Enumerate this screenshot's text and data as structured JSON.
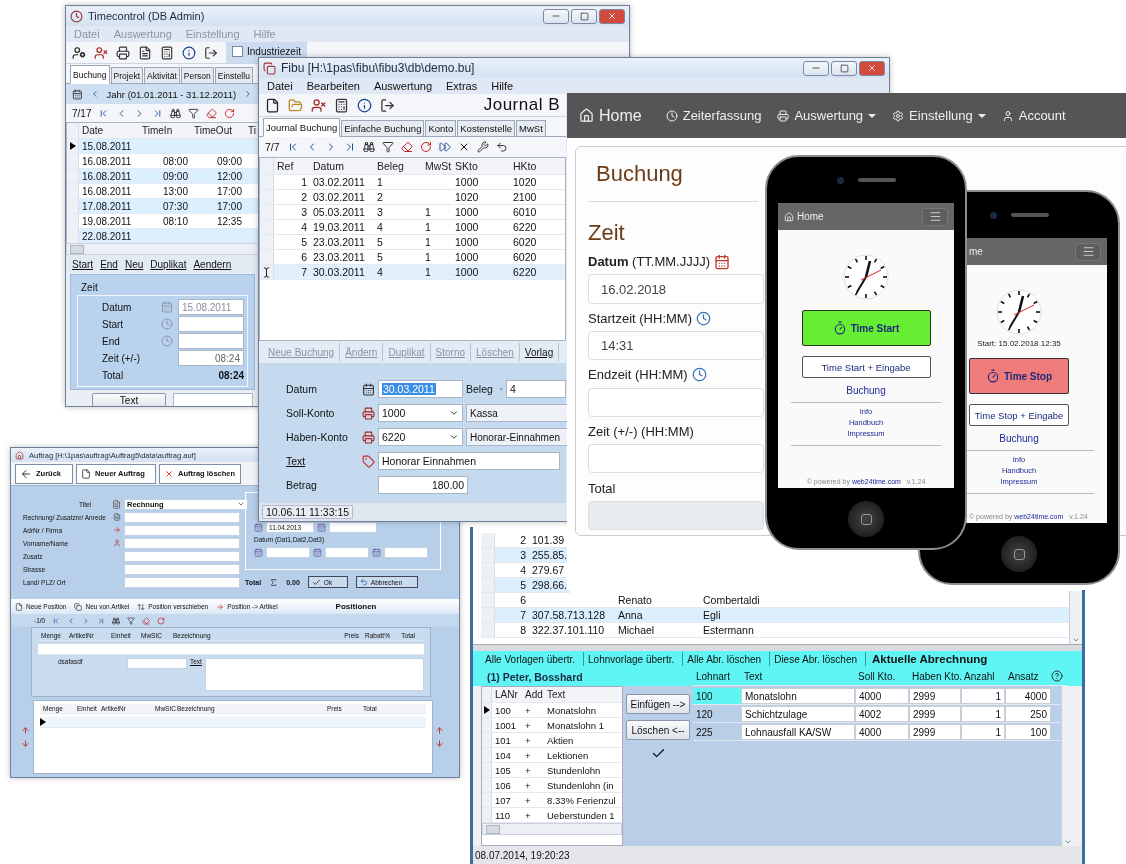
{
  "timecontrol": {
    "title": "Timecontrol (DB Admin)",
    "menu": [
      "Datei",
      "Auswertung",
      "Einstellung",
      "Hilfe"
    ],
    "option": {
      "label": "Industriezeit",
      "checked": false
    },
    "tabs": [
      {
        "label": "Buchung",
        "selected": true
      },
      {
        "label": "Projekt",
        "selected": false
      },
      {
        "label": "Aktivität",
        "selected": false
      },
      {
        "label": "Person",
        "selected": false
      },
      {
        "label": "Einstellu",
        "selected": false
      }
    ],
    "period": "Jahr (01.01.2011 - 31.12.2011)",
    "counter": "7/17",
    "columns": [
      "Date",
      "TimeIn",
      "TimeOut",
      "Ti"
    ],
    "rows": [
      {
        "date": "15.08.2011",
        "current": true
      },
      {
        "date": "16.08.2011",
        "time_in": "08:00",
        "time_out": "09:00",
        "current": false
      },
      {
        "date": "16.08.2011",
        "time_in": "09:00",
        "time_out": "12:00",
        "current": false
      },
      {
        "date": "16.08.2011",
        "time_in": "13:00",
        "time_out": "17:00",
        "current": false
      },
      {
        "date": "17.08.2011",
        "time_in": "07:30",
        "time_out": "17:00",
        "current": false
      },
      {
        "date": "19.08.2011",
        "time_in": "08:10",
        "time_out": "12:35",
        "current": false
      },
      {
        "date": "22.08.2011",
        "current": false
      }
    ],
    "actions": [
      "Start",
      "End",
      "Neu",
      "Duplikat",
      "Aendern"
    ],
    "group": {
      "title": "Zeit",
      "fields": [
        {
          "label": "Datum",
          "kind": "date",
          "value": "15.08.2011"
        },
        {
          "label": "Start",
          "kind": "time"
        },
        {
          "label": "End",
          "kind": "time"
        },
        {
          "label": "Zeit (+/-)",
          "kind": "plain",
          "value": "08:24"
        },
        {
          "label": "Total",
          "kind": "total",
          "value": "08:24"
        }
      ]
    },
    "button": "Text"
  },
  "fibu": {
    "title": "Fibu  [H:\\1pas\\fibu\\fibu3\\db\\demo.bu]",
    "menu": [
      "Datei",
      "Bearbeiten",
      "Auswertung",
      "Extras",
      "Hilfe"
    ],
    "heading": "Journal B",
    "tabs": [
      {
        "label": "Journal Buchung",
        "selected": true
      },
      {
        "label": "Einfache Buchung",
        "selected": false
      },
      {
        "label": "Konto",
        "selected": false
      },
      {
        "label": "Kostenstelle",
        "selected": false
      },
      {
        "label": "MwSt",
        "selected": false
      }
    ],
    "counter": "7/7",
    "columns": [
      "Ref",
      "Datum",
      "Beleg",
      "MwSt",
      "SKto",
      "HKto"
    ],
    "rows": [
      {
        "ref": "1",
        "datum": "03.02.2011",
        "beleg": "1",
        "skto": "1000",
        "hkto": "1020",
        "current": false
      },
      {
        "ref": "2",
        "datum": "03.02.2011",
        "beleg": "2",
        "skto": "1020",
        "hkto": "2100",
        "current": false
      },
      {
        "ref": "3",
        "datum": "05.03.2011",
        "beleg": "3",
        "mwst": "1",
        "skto": "1000",
        "hkto": "6010",
        "current": false
      },
      {
        "ref": "4",
        "datum": "19.03.2011",
        "beleg": "4",
        "mwst": "1",
        "skto": "1000",
        "hkto": "6220",
        "current": false
      },
      {
        "ref": "5",
        "datum": "23.03.2011",
        "beleg": "5",
        "mwst": "1",
        "skto": "1000",
        "hkto": "6020",
        "current": false
      },
      {
        "ref": "6",
        "datum": "23.03.2011",
        "beleg": "5",
        "mwst": "1",
        "skto": "1000",
        "hkto": "6020",
        "current": false
      },
      {
        "ref": "7",
        "datum": "30.03.2011",
        "beleg": "4",
        "mwst": "1",
        "skto": "1000",
        "hkto": "6220",
        "current": true
      }
    ],
    "actions": [
      {
        "label": "Neue Buchung",
        "disabled": true
      },
      {
        "label": "Ändern",
        "disabled": true
      },
      {
        "label": "Duplikat",
        "disabled": true
      },
      {
        "label": "Storno",
        "disabled": true
      },
      {
        "label": "Löschen",
        "disabled": true
      },
      {
        "label": "Vorlag",
        "disabled": false
      }
    ],
    "form": {
      "datum": {
        "label": "Datum",
        "value": "30.03.2011"
      },
      "beleg": {
        "label": "Beleg",
        "value": "4"
      },
      "soll": {
        "label": "Soll-Konto",
        "value": "1000",
        "name": "Kassa"
      },
      "haben": {
        "label": "Haben-Konto",
        "value": "6220",
        "name": "Honorar-Einnahmen"
      },
      "text": {
        "label": "Text",
        "value": "Honorar Einnahmen"
      },
      "betrag": {
        "label": "Betrag",
        "value": "180.00"
      }
    },
    "status": "10.06.11 11:33:15"
  },
  "web": {
    "nav": [
      {
        "label": "Home",
        "kind": "home",
        "dropdown": false
      },
      {
        "label": "Zeiterfassung",
        "kind": "clock",
        "dropdown": false
      },
      {
        "label": "Auswertung",
        "kind": "print",
        "dropdown": true
      },
      {
        "label": "Einstellung",
        "kind": "gear",
        "dropdown": true
      },
      {
        "label": "Account",
        "kind": "user",
        "dropdown": false
      }
    ],
    "title": "Buchung",
    "section": "Zeit",
    "fields": [
      {
        "label": "**Datum** (TT.MM.JJJJ)",
        "kind": "date",
        "value": "16.02.2018"
      },
      {
        "label": "Startzeit (HH:MM)",
        "kind": "time",
        "value": "14:31"
      },
      {
        "label": "Endzeit (HH:MM)",
        "kind": "time"
      },
      {
        "label": "Zeit (+/-) (HH:MM)",
        "kind": "plain"
      },
      {
        "label": "Total",
        "kind": "total"
      }
    ]
  },
  "phones": [
    {
      "nav_icon": true,
      "nav_title": "Home",
      "primary": {
        "label": "Time Start",
        "kind": "start"
      },
      "secondary": "Time Start + Eingabe",
      "link": "Buchung",
      "links": [
        "Info",
        "Handbuch",
        "Impressum"
      ],
      "footer": "© powered by",
      "footer_link": "web24time.com",
      "version": "v.1.24"
    },
    {
      "nav_icon": false,
      "nav_title": "me",
      "start_info": "Start: 15.02.2018 12:35",
      "primary": {
        "label": "Time Stop",
        "kind": "stop"
      },
      "secondary": "Time Stop + Eingabe",
      "link": "Buchung",
      "links": [
        "Info",
        "Handbuch",
        "Impressum"
      ],
      "footer": "© powered by",
      "footer_link": "web24time.com",
      "version": "v.1.24"
    }
  ],
  "lohn": {
    "rows": [
      {
        "num": "2",
        "id": "101.39"
      },
      {
        "num": "3",
        "id": "255.85."
      },
      {
        "num": "4",
        "id": "279.67"
      },
      {
        "num": "5",
        "id": "298.66."
      },
      {
        "num": "6",
        "first": "Renato",
        "last": "Combertaldi"
      },
      {
        "num": "7",
        "id": "307.58.713.128",
        "first": "Anna",
        "last": "Egli"
      },
      {
        "num": "8",
        "id": "322.37.101.110",
        "first": "Michael",
        "last": "Estermann"
      }
    ],
    "tools": [
      "Alle Vorlagen übertr.",
      "Lohnvorlage übertr.",
      "Alle Abr. löschen",
      "Diese Abr. löschen"
    ],
    "heading": "Aktuelle Abrechnung",
    "employee": "(1) Peter, Bosshard",
    "list_columns": [
      "LANr",
      "Add",
      "Text"
    ],
    "list": [
      {
        "nr": "100",
        "add": "+",
        "text": "Monatslohn",
        "current": true
      },
      {
        "nr": "1001",
        "add": "+",
        "text": "Monatslohn 1",
        "current": false
      },
      {
        "nr": "101",
        "add": "+",
        "text": "Aktien",
        "current": false
      },
      {
        "nr": "104",
        "add": "+",
        "text": "Lektionen",
        "current": false
      },
      {
        "nr": "105",
        "add": "+",
        "text": "Stundenlohn",
        "current": false
      },
      {
        "nr": "106",
        "add": "+",
        "text": "Stundenlohn (in",
        "current": false
      },
      {
        "nr": "107",
        "add": "+",
        "text": "8.33% Ferienzul",
        "current": false
      },
      {
        "nr": "110",
        "add": "+",
        "text": "Ueberstunden 1",
        "current": false
      }
    ],
    "buttons": [
      "Einfügen -->",
      "Löschen <--"
    ],
    "grid_columns": [
      "Lohnart",
      "Text",
      "Soll Kto.",
      "Haben Kto.",
      "Anzahl",
      "Ansatz"
    ],
    "grid": [
      {
        "cells": [
          "100",
          "Monatslohn",
          "4000",
          "2999",
          "1",
          "4000"
        ],
        "selected": true
      },
      {
        "cells": [
          "120",
          "Schichtzulage",
          "4002",
          "2999",
          "1",
          "250"
        ],
        "selected": false
      },
      {
        "cells": [
          "225",
          "Lohnausfall KA/SW",
          "4000",
          "2999",
          "1",
          "100"
        ],
        "selected": false
      }
    ],
    "status": "08.07.2014, 19:20:23"
  },
  "auftrag": {
    "title": "Auftrag [H:\\1pas\\auftrag\\Auftrag5\\data\\auftrag.auf]",
    "toolbar": [
      {
        "label": "Zurück",
        "kind": "back"
      },
      {
        "label": "Neuer Auftrag",
        "kind": "new"
      },
      {
        "label": "Auftrag löschen",
        "kind": "delete"
      }
    ],
    "title_label": "Titel",
    "title_value": "Rechnung",
    "labels": [
      "Rechnung/ Zusatznr/ Anrede",
      "AdrNr / Firma",
      "Vorname/Name",
      "Zusatz",
      "Strasse",
      "Land/ PLZ/ Ort"
    ],
    "date_value": "11.04.2013",
    "dates_label": "Datum (Dat1,Dat2,Dat3)",
    "total_label": "Total",
    "total_value": "0.00",
    "ok": "Ok",
    "cancel": "Abbrechen",
    "pos_tools": [
      "Neue Position",
      "Neu von Artikel",
      "Position verschieben",
      "Position -> Artikel"
    ],
    "pos_title": "Positionen",
    "counter": "-1/0",
    "grid1": [
      "Menge",
      "ArtikelNr",
      "Einheit",
      "MwStC",
      "Bezeichnung",
      "Preis",
      "Rabatt%",
      "Total"
    ],
    "field_label": "dsafasdf",
    "text_link": "Text",
    "grid2": [
      "Menge",
      "Einheit",
      "ArtikelNr",
      "MwStC",
      "Bezeichnung",
      "Preis",
      "Total"
    ]
  }
}
